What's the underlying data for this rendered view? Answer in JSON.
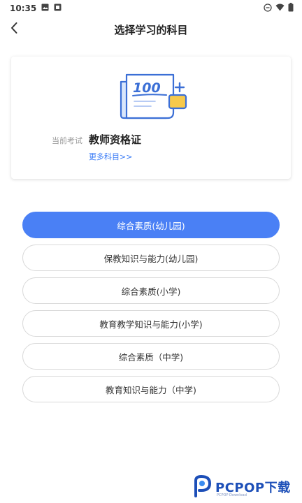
{
  "status_bar": {
    "time": "10:35",
    "left_icons": [
      "image-icon",
      "notification-icon"
    ],
    "right_icons": [
      "dnd-icon",
      "wifi-icon",
      "battery-icon"
    ]
  },
  "header": {
    "title": "选择学习的科目",
    "back_icon": "chevron-left-icon"
  },
  "exam_card": {
    "label": "当前考试",
    "name": "教师资格证",
    "more_link": "更多科目>>",
    "illustration_text": "100"
  },
  "subjects": [
    {
      "label": "综合素质(幼儿园)",
      "selected": true
    },
    {
      "label": "保教知识与能力(幼儿园)",
      "selected": false
    },
    {
      "label": "综合素质(小学)",
      "selected": false
    },
    {
      "label": "教育教学知识与能力(小学)",
      "selected": false
    },
    {
      "label": "综合素质（中学)",
      "selected": false
    },
    {
      "label": "教育知识与能力（中学)",
      "selected": false
    }
  ],
  "watermark": {
    "text": "PCPOP下载",
    "subtext": "PCPOP Download"
  },
  "colors": {
    "accent": "#4a80f5",
    "link": "#3b7cf6",
    "border": "#d9d9d9"
  }
}
